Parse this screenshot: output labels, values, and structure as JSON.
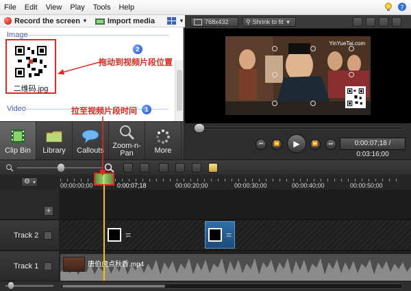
{
  "menu": [
    "File",
    "Edit",
    "View",
    "Play",
    "Tools",
    "Help"
  ],
  "toolbar": {
    "record_label": "Record the screen",
    "import_label": "Import media"
  },
  "clip_bin": {
    "section_image": "Image",
    "image_file": "二维码.jpg",
    "section_video": "Video"
  },
  "annotations": {
    "drag_text": "拖动到视频片段位置",
    "drag_num": "2",
    "pull_text": "拉至视频片段时间",
    "pull_num": "1"
  },
  "tools": [
    {
      "label": "Clip Bin",
      "icon": "film-icon"
    },
    {
      "label": "Library",
      "icon": "folder-icon"
    },
    {
      "label": "Callouts",
      "icon": "speech-bubble-icon"
    },
    {
      "label": "Zoom-n-\nPan",
      "icon": "magnifier-icon"
    },
    {
      "label": "More",
      "icon": "spinner-icon"
    }
  ],
  "preview": {
    "resolution": "768x432",
    "fit_mode": "Shrink to fit",
    "watermark": "YinYueTai.com",
    "time": "0:00:07;18 / 0:03:16;00"
  },
  "timeline": {
    "ticks": [
      "00:00:00;00",
      "0:00:07;18",
      "00:00:20;00",
      "00:00:30;00",
      "00:00:40;00",
      "00:00:50;00"
    ],
    "tracks": [
      {
        "name": "Track 2"
      },
      {
        "name": "Track 1",
        "clip": "唐伯虎点秋香.mp4"
      }
    ]
  },
  "colors": {
    "annotation_red": "#e02a1f",
    "playhead_yellow": "#f2c400",
    "accent_blue": "#3b62c9"
  }
}
